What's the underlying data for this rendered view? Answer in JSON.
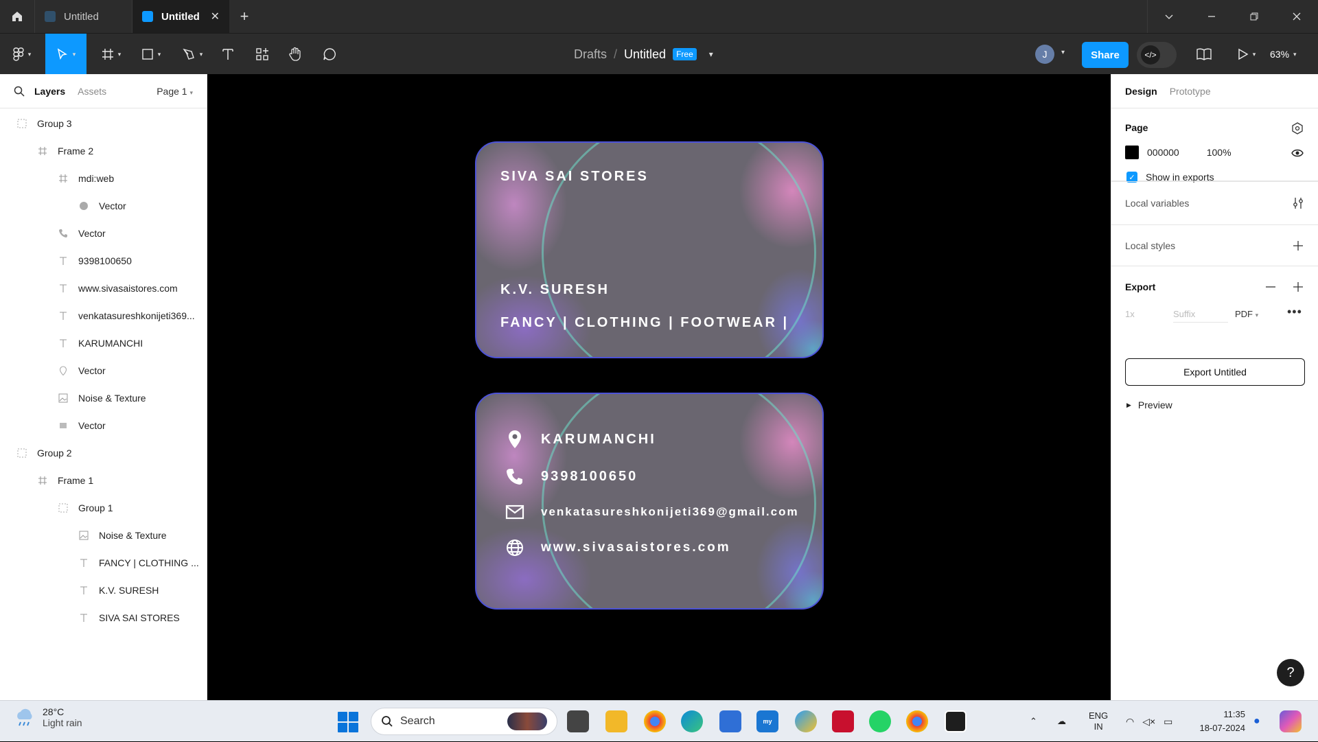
{
  "titlebar": {
    "tabs": [
      {
        "label": "Untitled",
        "active": false
      },
      {
        "label": "Untitled",
        "active": true,
        "close": "✕"
      }
    ],
    "new_tab": "+"
  },
  "toolbar": {
    "breadcrumb": {
      "parent": "Drafts",
      "separator": "/",
      "file": "Untitled",
      "badge": "Free"
    },
    "avatar_initial": "J",
    "share_label": "Share",
    "zoom": "63%"
  },
  "left_panel": {
    "tabs": {
      "layers": "Layers",
      "assets": "Assets",
      "page": "Page 1"
    },
    "layers": [
      {
        "label": "Group 3",
        "icon": "group-icon",
        "depth": 0
      },
      {
        "label": "Frame 2",
        "icon": "frame-icon",
        "depth": 1
      },
      {
        "label": "mdi:web",
        "icon": "frame-icon",
        "depth": 2
      },
      {
        "label": "Vector",
        "icon": "globe-icon",
        "depth": 3
      },
      {
        "label": "Vector",
        "icon": "phone-icon",
        "depth": 2
      },
      {
        "label": "9398100650",
        "icon": "text-icon",
        "depth": 2
      },
      {
        "label": "www.sivasaistores.com",
        "icon": "text-icon",
        "depth": 2
      },
      {
        "label": "venkatasureshkonijeti369...",
        "icon": "text-icon",
        "depth": 2
      },
      {
        "label": "KARUMANCHI",
        "icon": "text-icon",
        "depth": 2
      },
      {
        "label": "Vector",
        "icon": "location-icon",
        "depth": 2
      },
      {
        "label": "Noise & Texture",
        "icon": "image-icon",
        "depth": 2
      },
      {
        "label": "Vector",
        "icon": "mail-icon",
        "depth": 2
      },
      {
        "label": "Group 2",
        "icon": "group-icon",
        "depth": 0
      },
      {
        "label": "Frame 1",
        "icon": "frame-icon",
        "depth": 1
      },
      {
        "label": "Group 1",
        "icon": "group-icon",
        "depth": 2
      },
      {
        "label": "Noise & Texture",
        "icon": "image-icon",
        "depth": 3
      },
      {
        "label": "FANCY | CLOTHING ...",
        "icon": "text-icon",
        "depth": 3
      },
      {
        "label": "K.V. SURESH",
        "icon": "text-icon",
        "depth": 3
      },
      {
        "label": "SIVA SAI STORES",
        "icon": "text-icon",
        "depth": 3
      }
    ]
  },
  "canvas": {
    "card_front": {
      "store": "SIVA SAI STORES",
      "owner": "K.V. SURESH",
      "tagline": "FANCY | CLOTHING | FOOTWEAR |"
    },
    "card_back": {
      "location": "KARUMANCHI",
      "phone": "9398100650",
      "email": "venkatasureshkonijeti369@gmail.com",
      "website": "www.sivasaistores.com"
    },
    "background_color": "#000000",
    "card_border_color": "#4c52d8"
  },
  "right_panel": {
    "tabs": {
      "design": "Design",
      "prototype": "Prototype"
    },
    "page": {
      "title": "Page",
      "color_hex": "000000",
      "opacity": "100%",
      "show_in_exports": "Show in exports"
    },
    "local_variables": "Local variables",
    "local_styles": "Local styles",
    "export": {
      "title": "Export",
      "scale": "1x",
      "suffix_placeholder": "Suffix",
      "format": "PDF",
      "button": "Export Untitled",
      "preview": "Preview"
    }
  },
  "help": "?",
  "taskbar": {
    "weather": {
      "temp": "28°C",
      "condition": "Light rain"
    },
    "search": "Search",
    "lang": {
      "line1": "ENG",
      "line2": "IN"
    },
    "time": "11:35",
    "date": "18-07-2024"
  },
  "colors": {
    "accent": "#0d99ff",
    "toolbar": "#2c2c2c"
  }
}
